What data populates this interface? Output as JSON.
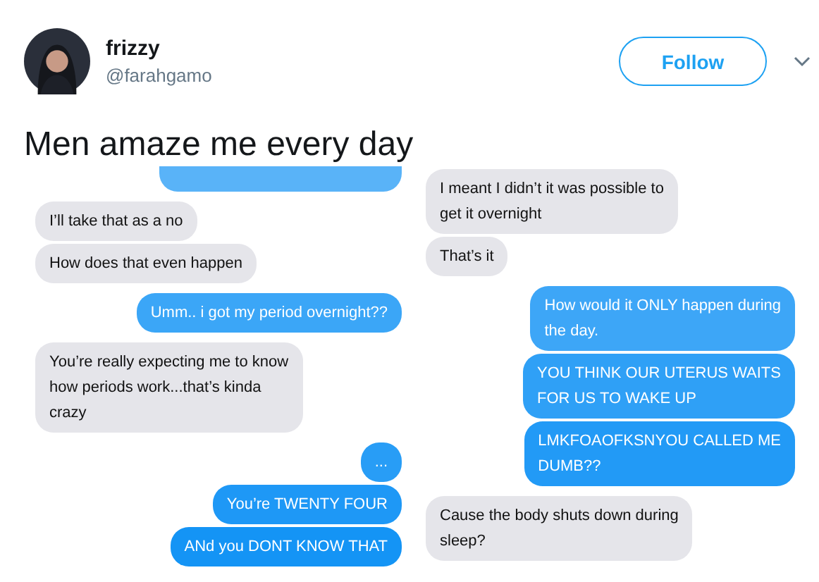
{
  "author": {
    "name": "frizzy",
    "handle": "@farahgamo"
  },
  "follow_button": {
    "label": "Follow"
  },
  "tweet_text": "Men amaze me every day",
  "chat_panels": [
    {
      "messages": [
        {
          "kind": "sent"
        },
        {
          "kind": "received",
          "text": "I’ll take that as a no"
        },
        {
          "kind": "received",
          "text": "How does that even happen"
        },
        {
          "kind": "sent",
          "text": "Umm.. i got my period overnight??"
        },
        {
          "kind": "received",
          "text": "You’re really expecting me to know\nhow periods work...that’s kinda\ncrazy"
        },
        {
          "kind": "sent",
          "text": "..."
        },
        {
          "kind": "sent",
          "text": "You’re TWENTY FOUR"
        },
        {
          "kind": "sent",
          "text": "ANd you DONT KNOW THAT"
        }
      ]
    },
    {
      "messages": [
        {
          "kind": "received",
          "text": "I meant I didn’t it was possible to\nget it overnight"
        },
        {
          "kind": "received",
          "text": "That’s it"
        },
        {
          "kind": "sent",
          "text": "How would it ONLY happen during\nthe day."
        },
        {
          "kind": "sent",
          "text": "YOU THINK OUR UTERUS WAITS\nFOR US TO WAKE UP"
        },
        {
          "kind": "sent",
          "text": "LMKFOAOFKSNYOU CALLED ME\nDUMB??"
        },
        {
          "kind": "received",
          "text": "Cause the body shuts down during\nsleep?"
        }
      ]
    }
  ]
}
